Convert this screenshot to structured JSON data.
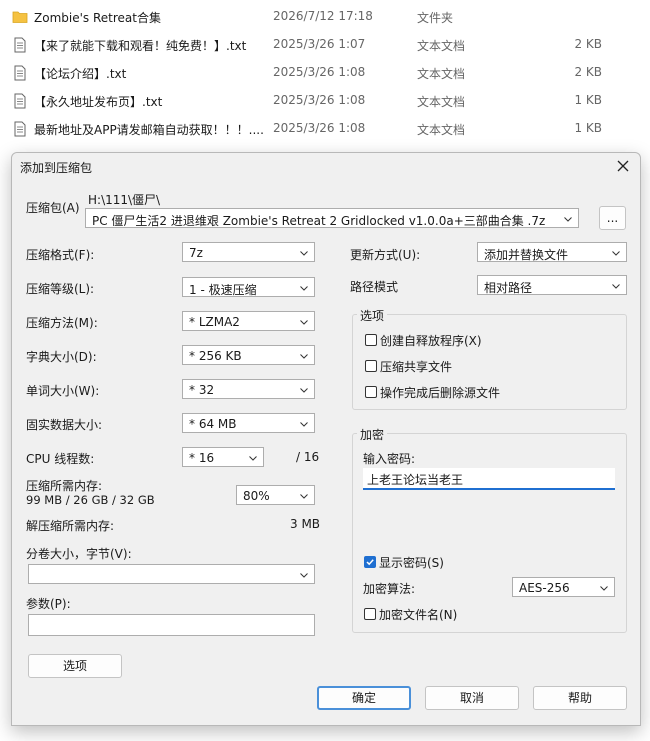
{
  "file_list": [
    {
      "name": "Zombie's Retreat合集",
      "date": "2026/7/12 17:18",
      "type": "文件夹",
      "size": "",
      "icon": "folder-icon"
    },
    {
      "name": "【来了就能下载和观看！纯免费！】.txt",
      "date": "2025/3/26 1:07",
      "type": "文本文档",
      "size": "2 KB",
      "icon": "text-file-icon"
    },
    {
      "name": "【论坛介绍】.txt",
      "date": "2025/3/26 1:08",
      "type": "文本文档",
      "size": "2 KB",
      "icon": "text-file-icon"
    },
    {
      "name": "【永久地址发布页】.txt",
      "date": "2025/3/26 1:08",
      "type": "文本文档",
      "size": "1 KB",
      "icon": "text-file-icon"
    },
    {
      "name": "最新地址及APP请发邮箱自动获取！！！....",
      "date": "2025/3/26 1:08",
      "type": "文本文档",
      "size": "1 KB",
      "icon": "text-file-icon"
    }
  ],
  "dialog": {
    "title": "添加到压缩包",
    "archive_label": "压缩包(A)",
    "archive_path": "H:\\111\\僵尸\\",
    "archive_name": "PC 僵尸生活2 进退维艰 Zombie's Retreat 2 Gridlocked v1.0.0a+三部曲合集 .7z",
    "browse_label": "...",
    "left": {
      "format_label": "压缩格式(F):",
      "format_value": "7z",
      "level_label": "压缩等级(L):",
      "level_value": "1 - 极速压缩",
      "method_label": "压缩方法(M):",
      "method_value": "*  LZMA2",
      "dict_label": "字典大小(D):",
      "dict_value": "*  256 KB",
      "word_label": "单词大小(W):",
      "word_value": "*  32",
      "solid_label": "固实数据大小:",
      "solid_value": "*  64 MB",
      "threads_label": "CPU 线程数:",
      "threads_value": "*  16",
      "threads_total": "/ 16",
      "mem_comp_label": "压缩所需内存:",
      "mem_comp_detail": "99 MB / 26 GB / 32 GB",
      "mem_comp_value": "80%",
      "mem_decomp_label": "解压缩所需内存:",
      "mem_decomp_value": "3 MB",
      "split_label": "分卷大小，字节(V):",
      "split_value": "",
      "params_label": "参数(P):",
      "params_value": "",
      "options_button": "选项"
    },
    "right": {
      "update_label": "更新方式(U):",
      "update_value": "添加并替换文件",
      "path_label": "路径模式",
      "path_value": "相对路径",
      "options_group": "选项",
      "sfx_label": "创建自释放程序(X)",
      "sfx_checked": false,
      "shared_label": "压缩共享文件",
      "shared_checked": false,
      "delete_label": "操作完成后删除源文件",
      "delete_checked": false,
      "encrypt_group": "加密",
      "pwd_label": "输入密码:",
      "pwd_value": "上老王论坛当老王",
      "show_pwd_label": "显示密码(S)",
      "show_pwd_checked": true,
      "enc_method_label": "加密算法:",
      "enc_method_value": "AES-256",
      "enc_names_label": "加密文件名(N)",
      "enc_names_checked": false
    },
    "ok_button": "确定",
    "cancel_button": "取消",
    "help_button": "帮助"
  },
  "colors": {
    "accent": "#1f6fd1",
    "focus_border": "#4a90d9",
    "folder": "#f5c242"
  }
}
